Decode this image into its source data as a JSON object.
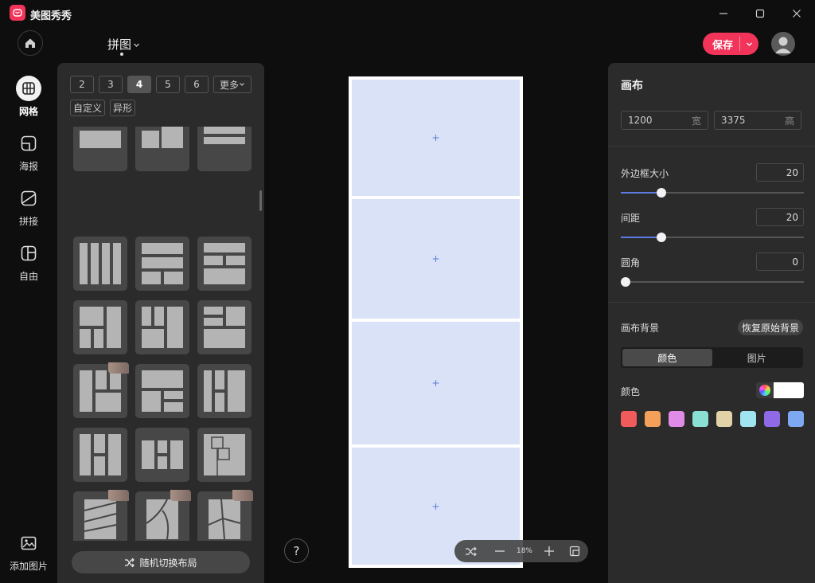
{
  "app": {
    "title": "美图秀秀"
  },
  "header": {
    "mode_label": "拼图",
    "save_label": "保存"
  },
  "rail": {
    "items": [
      {
        "label": "网格",
        "icon": "grid-icon",
        "active": true
      },
      {
        "label": "海报",
        "icon": "poster-icon"
      },
      {
        "label": "拼接",
        "icon": "splice-icon"
      },
      {
        "label": "自由",
        "icon": "free-layout-icon"
      }
    ],
    "add_label": "添加图片"
  },
  "layout_panel": {
    "counts": [
      "2",
      "3",
      "4",
      "5",
      "6"
    ],
    "active_count": "4",
    "more_label": "更多",
    "types": [
      "自定义",
      "异形"
    ],
    "random_label": "随机切换布局"
  },
  "canvas": {
    "cell_placeholder": "+",
    "cells": 4
  },
  "zoom": {
    "level": "18%"
  },
  "help": {
    "label": "?"
  },
  "props": {
    "title": "画布",
    "width": {
      "value": "1200",
      "unit": "宽"
    },
    "height": {
      "value": "3375",
      "unit": "高"
    },
    "border": {
      "label": "外边框大小",
      "value": "20",
      "fraction": 0.22
    },
    "gap": {
      "label": "间距",
      "value": "20",
      "fraction": 0.22
    },
    "radius": {
      "label": "圆角",
      "value": "0",
      "fraction": 0.0
    },
    "bg_label": "画布背景",
    "reset_label": "恢复原始背景",
    "bg_tabs": [
      "颜色",
      "图片"
    ],
    "color_label": "颜色",
    "swatches": [
      "#f25b5b",
      "#f5a05a",
      "#e08be8",
      "#8ae0d2",
      "#e2d2a8",
      "#9fe4f0",
      "#8f6ae6",
      "#7fa8f2"
    ]
  },
  "colors": {
    "accent": "#f2345a",
    "selection": "#5b7be0",
    "cell_bg": "#dae2f7"
  }
}
